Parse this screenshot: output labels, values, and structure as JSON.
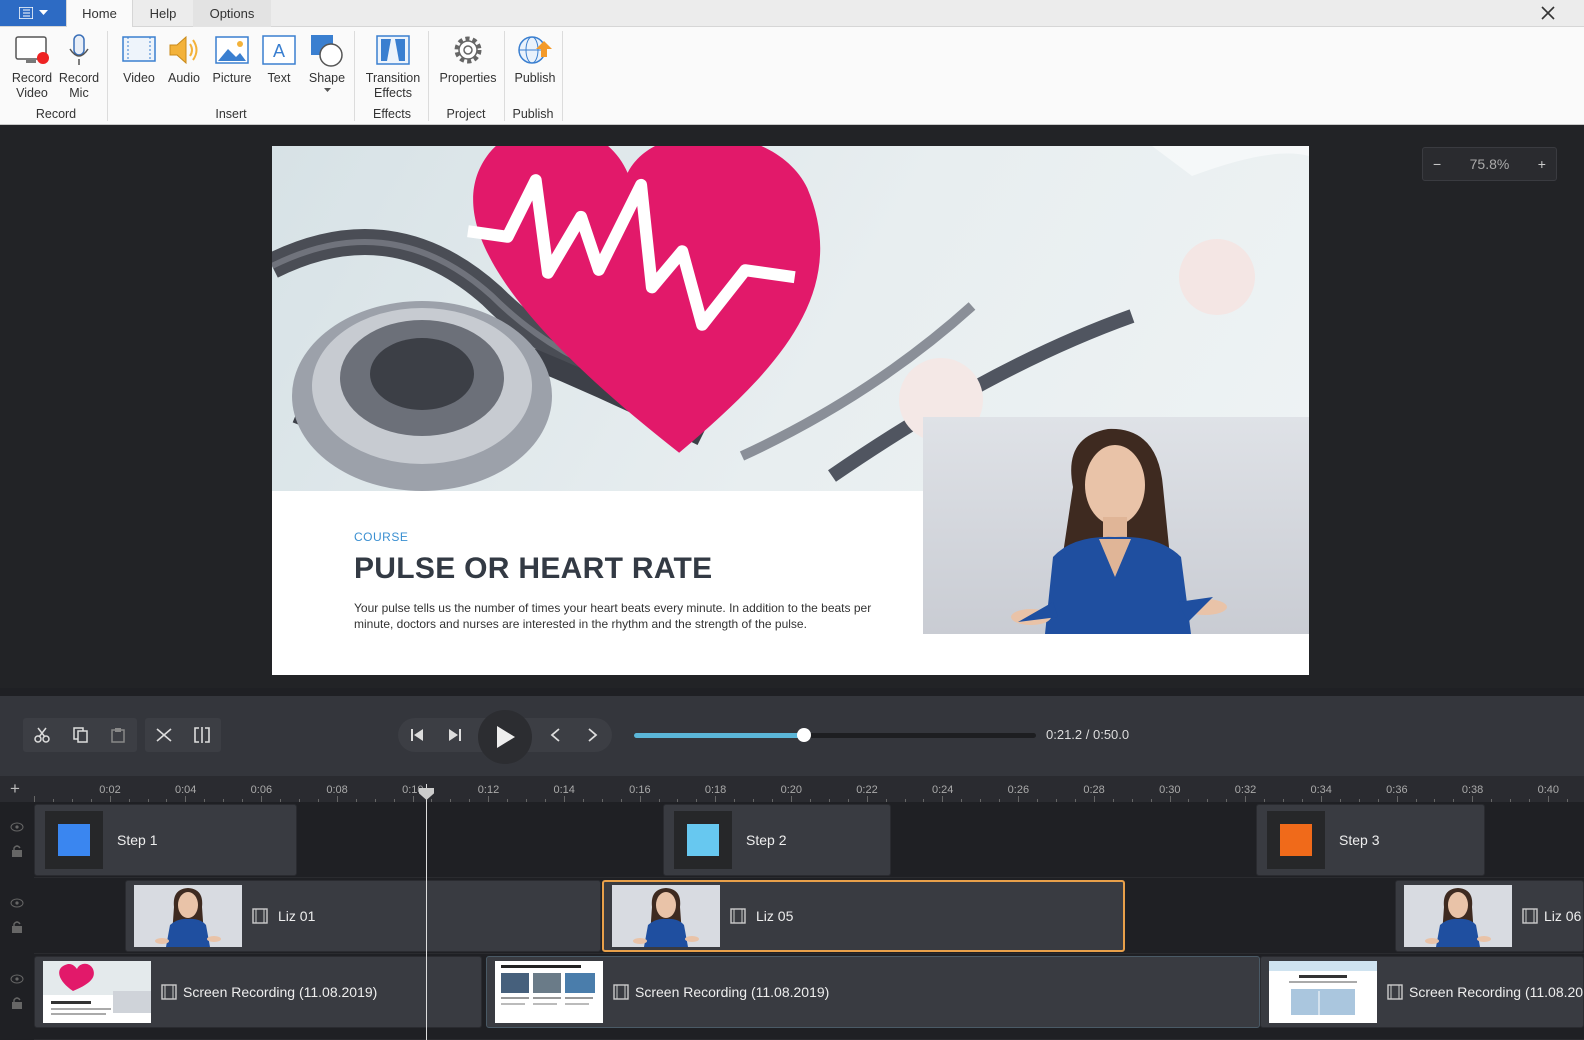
{
  "ribbon": {
    "tabs": [
      "Home",
      "Help",
      "Options"
    ],
    "buttons": {
      "record_video": "Record\nVideo",
      "record_mic": "Record\nMic",
      "video": "Video",
      "audio": "Audio",
      "picture": "Picture",
      "text": "Text",
      "shape": "Shape",
      "transition": "Transition\nEffects",
      "properties": "Properties",
      "publish": "Publish"
    },
    "groups": [
      "Record",
      "Insert",
      "Effects",
      "Project",
      "Publish"
    ]
  },
  "slide": {
    "kicker": "COURSE",
    "title": "PULSE OR HEART RATE",
    "body": "Your pulse tells us the number of times your heart beats every minute. In addition to the beats per minute, doctors and nurses are interested in the rhythm and the strength of the pulse."
  },
  "zoom": {
    "minus": "−",
    "value": "75.8%",
    "plus": "+"
  },
  "player": {
    "time": "0:21.2 / 0:50.0",
    "progress": 0.424
  },
  "ruler": {
    "labels": [
      "0:02",
      "0:04",
      "0:06",
      "0:08",
      "0:10",
      "0:12",
      "0:14",
      "0:16",
      "0:18",
      "0:20",
      "0:22",
      "0:24",
      "0:26",
      "0:28",
      "0:30",
      "0:32",
      "0:34",
      "0:36",
      "0:38",
      "0:40"
    ],
    "add": "+"
  },
  "tracks": {
    "steps": [
      {
        "label": "Step 1",
        "color": "#3a86f0"
      },
      {
        "label": "Step 2",
        "color": "#67c8f0"
      },
      {
        "label": "Step 3",
        "color": "#f06a1a"
      }
    ],
    "videos": [
      "Liz 01",
      "Liz 05",
      "Liz 06"
    ],
    "recordings": [
      "Screen Recording (11.08.2019)",
      "Screen Recording (11.08.2019)",
      "Screen Recording (11.08.20"
    ]
  }
}
